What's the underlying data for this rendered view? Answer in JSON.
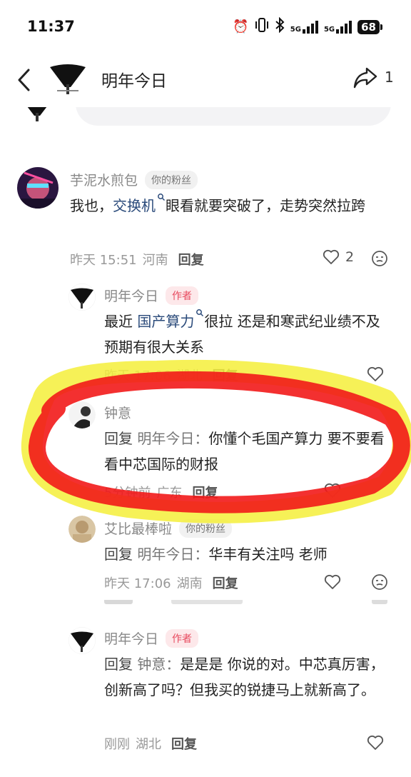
{
  "status_bar": {
    "time": "11:37",
    "icons": [
      "alarm-icon",
      "vibrate-icon",
      "bluetooth-icon",
      "signal-5g-icon",
      "signal-5g-icon"
    ],
    "signal_label_1": "5G",
    "signal_label_2": "5G",
    "battery": "68"
  },
  "header": {
    "title": "明年今日",
    "share_count": "1"
  },
  "comments": [
    {
      "name": "芋泥水煎包",
      "tag": "你的粉丝",
      "text_before": "我也，",
      "link": "交换机",
      "text_after": "眼看就要突破了，走势突然拉跨",
      "time": "昨天 15:51",
      "location": "河南",
      "reply_label": "回复",
      "likes": "2"
    },
    {
      "name": "明年今日",
      "tag": "作者",
      "text_before": "最近 ",
      "link": "国产算力",
      "text_after": "很拉 还是和寒武纪业绩不及预期有很大关系",
      "time": "昨天 17:06",
      "location": "湖北",
      "reply_label": "回复"
    },
    {
      "name": "钟意",
      "reply_prefix": "回复",
      "reply_target": "明年今日：",
      "text": "你懂个毛国产算力 要不要看看中芯国际的财报",
      "time": "5分钟前",
      "location": "广东",
      "reply_label": "回复"
    },
    {
      "name": "艾比最棒啦",
      "tag": "你的粉丝",
      "reply_prefix": "回复",
      "reply_target": "明年今日：",
      "text": "华丰有关注吗 老师",
      "time": "昨天 17:06",
      "location": "湖南",
      "reply_label": "回复"
    },
    {
      "name": "明年今日",
      "tag": "作者",
      "reply_prefix": "回复",
      "reply_target": "钟意：",
      "text": "是是是 你说的对。中芯真厉害，创新高了吗？但我买的锐捷马上就新高了。",
      "time": "刚刚",
      "location": "湖北",
      "reply_label": "回复"
    }
  ],
  "annotation": {
    "highlight_colors": [
      "#f21a1a",
      "#f5ef3a"
    ]
  }
}
